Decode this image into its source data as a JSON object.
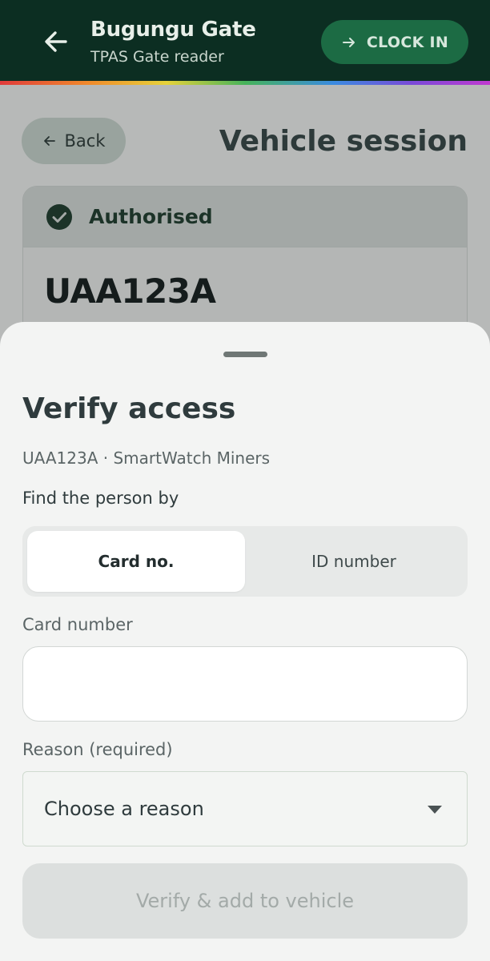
{
  "appbar": {
    "title": "Bugungu Gate",
    "subtitle": "TPAS Gate reader",
    "clock_in_label": "CLOCK IN"
  },
  "page": {
    "back_label": "Back",
    "title": "Vehicle session",
    "status": "Authorised",
    "plate": "UAA123A"
  },
  "sheet": {
    "title": "Verify access",
    "subtitle": "UAA123A · SmartWatch Miners",
    "find_by_label": "Find the person by",
    "tabs": [
      {
        "label": "Card no.",
        "active": true
      },
      {
        "label": "ID number",
        "active": false
      }
    ],
    "card_number_label": "Card number",
    "card_number_value": "",
    "reason_label": "Reason (required)",
    "reason_value": "Choose a reason",
    "submit_label": "Verify & add to vehicle"
  },
  "colors": {
    "appbar_bg": "#0c2e22",
    "clock_in_bg": "#1c6b44",
    "authorised_green": "#1c3328",
    "disabled_button": "#dcdfde"
  }
}
